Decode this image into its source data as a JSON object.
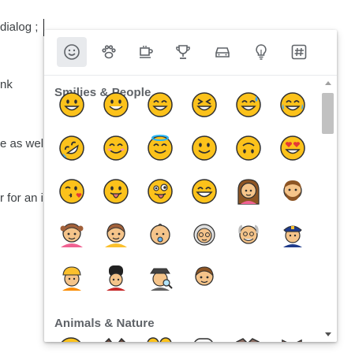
{
  "document": {
    "lines": [
      "dialog ;",
      "nk",
      "e as wel",
      "r for an i"
    ]
  },
  "picker": {
    "tabs": [
      {
        "icon": "smiley-icon",
        "active": true
      },
      {
        "icon": "paw-icon",
        "active": false
      },
      {
        "icon": "coffee-icon",
        "active": false
      },
      {
        "icon": "trophy-icon",
        "active": false
      },
      {
        "icon": "car-icon",
        "active": false
      },
      {
        "icon": "lightbulb-icon",
        "active": false
      },
      {
        "icon": "hash-icon",
        "active": false
      }
    ],
    "sections": [
      {
        "title": "Smilies & People"
      },
      {
        "title": "Animals & Nature"
      }
    ],
    "smilies": [
      "grinning-face",
      "grinning-big-eyes",
      "grinning-smiling-eyes",
      "squinting-laughing",
      "sweat-smile",
      "tears-of-joy",
      "rolling-laughing",
      "smiling-blush",
      "halo",
      "slightly-smiling",
      "upside-down",
      "heart-eyes",
      "kissing-heart",
      "tongue-out",
      "winking-tongue",
      "grinning-wide",
      "woman",
      "man-beard",
      "girl",
      "boy",
      "baby",
      "old-woman",
      "old-man",
      "police-officer",
      "construction-worker",
      "guard",
      "detective",
      "child"
    ]
  },
  "colors": {
    "face": "#fcc21b",
    "face_outline": "#2f2f2f",
    "accent": "#5f6368",
    "scroll_thumb": "#c1c1c1"
  }
}
